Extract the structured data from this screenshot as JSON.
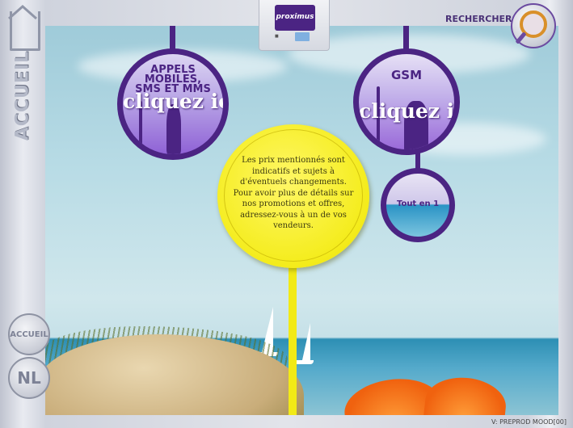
{
  "header": {
    "search_label": "RECHERCHER",
    "logo_text": "proximus"
  },
  "left_rail": {
    "home_vertical_label": "ACCUEIL",
    "home_button_label": "ACCUEIL",
    "language_button_label": "NL"
  },
  "bubbles": {
    "appels": {
      "title": "APPELS MOBILES, SMS ET MMS",
      "cta": "cliquez ici"
    },
    "gsm": {
      "title": "GSM",
      "cta": "cliquez ici"
    },
    "tout_en_1": {
      "label": "Tout en 1"
    }
  },
  "notice": {
    "text": "Les prix mentionnés sont indicatifs et sujets à d'éventuels changements. Pour avoir plus de détails sur nos promotions et offres, adressez-vous à un de vos vendeurs."
  },
  "footer": {
    "version": "V: PREPROD MOOD[00]"
  },
  "colors": {
    "brand_purple": "#4b2483",
    "notice_yellow": "#f4ec1b"
  }
}
